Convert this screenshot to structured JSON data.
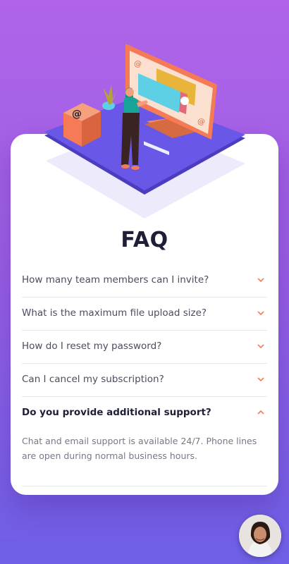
{
  "page": {
    "title": "FAQ"
  },
  "faq": [
    {
      "question": "How many team members can I invite?",
      "open": false
    },
    {
      "question": "What is the maximum file upload size?",
      "open": false
    },
    {
      "question": "How do I reset my password?",
      "open": false
    },
    {
      "question": "Can I cancel my subscription?",
      "open": false
    },
    {
      "question": "Do you provide additional support?",
      "open": true,
      "answer": "Chat and email support is available 24/7. Phone lines are open during normal business hours."
    }
  ],
  "colors": {
    "accent": "#f47b56",
    "heading": "#1e1f36",
    "text": "#4b4c5f",
    "muted": "#787887"
  },
  "icons": {
    "collapsed": "chevron-down-icon",
    "expanded": "chevron-up-icon"
  }
}
